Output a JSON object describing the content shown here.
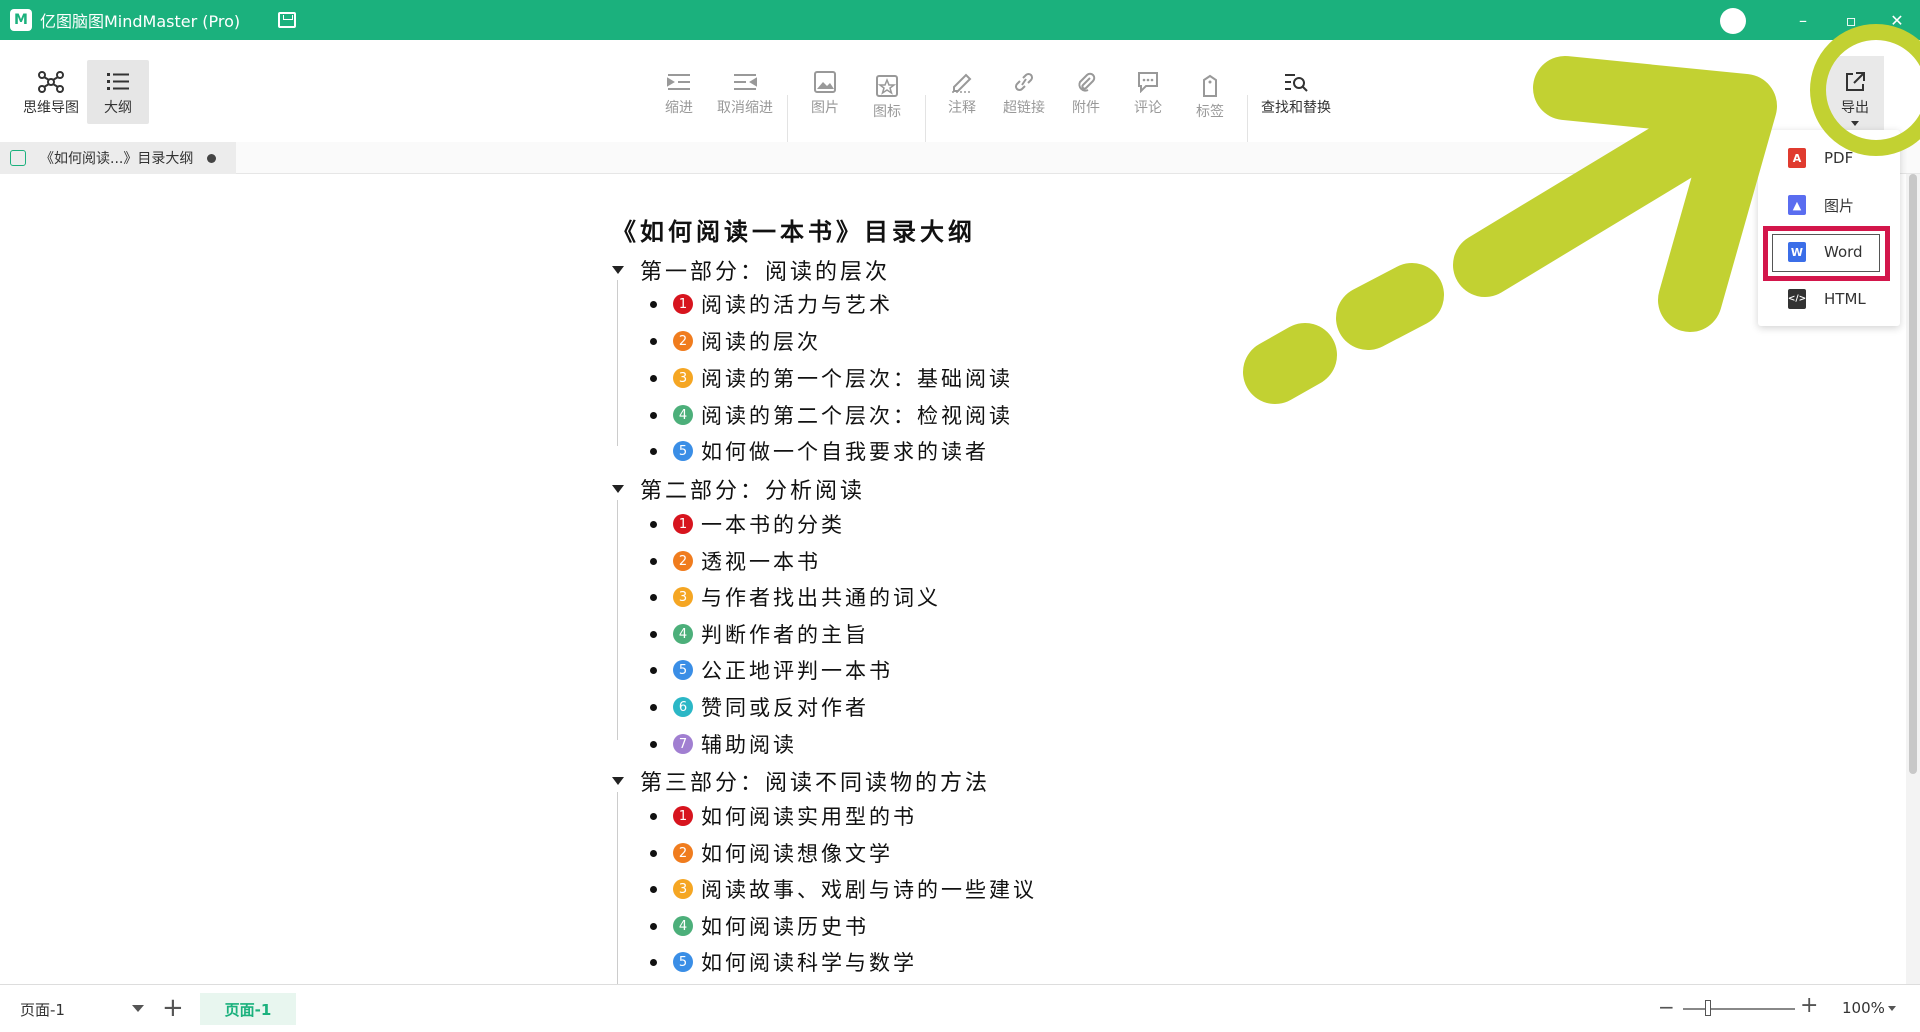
{
  "titlebar": {
    "title": "亿图脑图MindMaster (Pro)",
    "logo": "M",
    "minimize": "–",
    "restore": "▫",
    "close": "✕"
  },
  "toolbar": {
    "mindmap_label": "思维导图",
    "outline_label": "大纲",
    "indent_label": "缩进",
    "unindent_label": "取消缩进",
    "image_label": "图片",
    "icon_label": "图标",
    "note_label": "注释",
    "hyperlink_label": "超链接",
    "attachment_label": "附件",
    "comment_label": "评论",
    "tag_label": "标签",
    "find_replace_label": "查找和替换",
    "export_label": "导出"
  },
  "tab": {
    "name": "《如何阅读...》目录大纲"
  },
  "outline": {
    "title": "《如何阅读一本书》目录大纲",
    "sections": [
      {
        "label": "第一部分：阅读的层次",
        "items": [
          "阅读的活力与艺术",
          "阅读的层次",
          "阅读的第一个层次：基础阅读",
          "阅读的第二个层次：检视阅读",
          "如何做一个自我要求的读者"
        ]
      },
      {
        "label": "第二部分：分析阅读",
        "items": [
          "一本书的分类",
          "透视一本书",
          "与作者找出共通的词义",
          "判断作者的主旨",
          "公正地评判一本书",
          "赞同或反对作者",
          "辅助阅读"
        ]
      },
      {
        "label": "第三部分：阅读不同读物的方法",
        "items": [
          "如何阅读实用型的书",
          "如何阅读想像文学",
          "阅读故事、戏剧与诗的一些建议",
          "如何阅读历史书",
          "如何阅读科学与数学"
        ]
      }
    ],
    "number_colors": [
      "#d7141e",
      "#f07c1e",
      "#f5a623",
      "#4caf7a",
      "#3a8ee6",
      "#2bb7c6",
      "#a17fd1"
    ]
  },
  "export_menu": {
    "items": [
      {
        "label": "PDF",
        "icon": "pdf-icon",
        "color": "#e03b2f",
        "glyph": "A"
      },
      {
        "label": "图片",
        "icon": "image-icon",
        "color": "#5a6df0",
        "glyph": "▲"
      },
      {
        "label": "Word",
        "icon": "word-icon",
        "color": "#3b6ee8",
        "glyph": "W"
      },
      {
        "label": "HTML",
        "icon": "html-icon",
        "color": "#333333",
        "glyph": "</>"
      }
    ],
    "highlight_color": "#d3164b"
  },
  "footer": {
    "page_select": "页面-1",
    "add_page": "+",
    "page_tab": "页面-1",
    "zoom_minus": "−",
    "zoom_plus": "+",
    "zoom_value": "100%"
  },
  "annotation": {
    "arrow_color": "#c2d132"
  },
  "colors": {
    "brand": "#1bb17d"
  }
}
